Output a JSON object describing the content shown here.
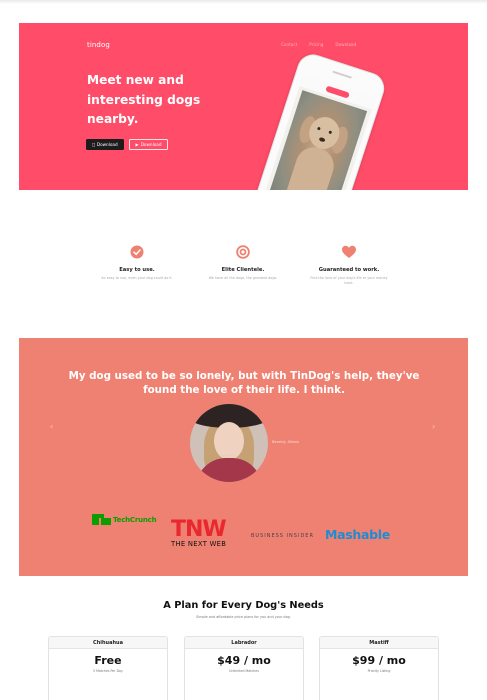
{
  "hero": {
    "brand": "tindog",
    "nav": [
      "Contact",
      "Pricing",
      "Download"
    ],
    "headline": "Meet new and interesting dogs nearby.",
    "buttons": {
      "apple": "Download",
      "google": "Download"
    },
    "accent": "#ff4c68"
  },
  "features": [
    {
      "icon": "check-circle-icon",
      "title": "Easy to use.",
      "desc": "So easy to use, even your dog could do it."
    },
    {
      "icon": "target-icon",
      "title": "Elite Clientele.",
      "desc": "We have all the dogs, the greatest dogs."
    },
    {
      "icon": "heart-icon",
      "title": "Guaranteed to work.",
      "desc": "Find the love of your dog's life or your money back."
    }
  ],
  "testimonial": {
    "quote": "My dog used to be so lonely, but with TinDog's help, they've found the love of their life. I think.",
    "author": "Beverly, Illinois",
    "background": "#ef8172"
  },
  "press": {
    "techcrunch": "TechCrunch",
    "tnw_big": "TNW",
    "tnw_small": "THE NEXT WEB",
    "business_insider": "BUSINESS INSIDER",
    "mashable": "Mashable"
  },
  "pricing": {
    "title": "A Plan for Every Dog's Needs",
    "subtitle": "Simple and affordable price plans for you and your dog.",
    "plans": [
      {
        "name": "Chihuahua",
        "price": "Free",
        "feature": "5 Matches Per Day"
      },
      {
        "name": "Labrador",
        "price": "$49 / mo",
        "feature": "Unlimited Matches"
      },
      {
        "name": "Mastiff",
        "price": "$99 / mo",
        "feature": "Priority Listing"
      }
    ]
  }
}
